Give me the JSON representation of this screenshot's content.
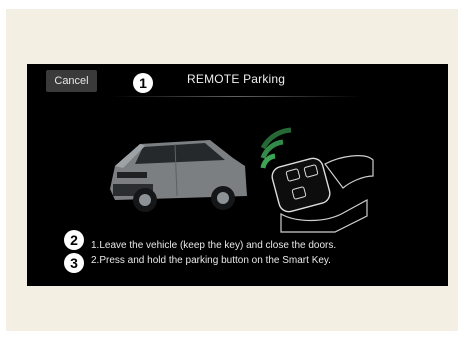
{
  "header": {
    "cancel_label": "Cancel",
    "title": "REMOTE Parking"
  },
  "callouts": [
    "1",
    "2",
    "3"
  ],
  "instructions": [
    "1.Leave the vehicle (keep the key) and close the doors.",
    "2.Press and hold the parking button on the Smart Key."
  ],
  "colors": {
    "screen_bg": "#000000",
    "frame_bg": "#f4efe3",
    "signal_green": "#3fae5a"
  },
  "illustration": {
    "car_icon": "suv-car-icon",
    "key_icon": "smart-key-icon",
    "signal_icon": "wireless-signal-icon"
  }
}
